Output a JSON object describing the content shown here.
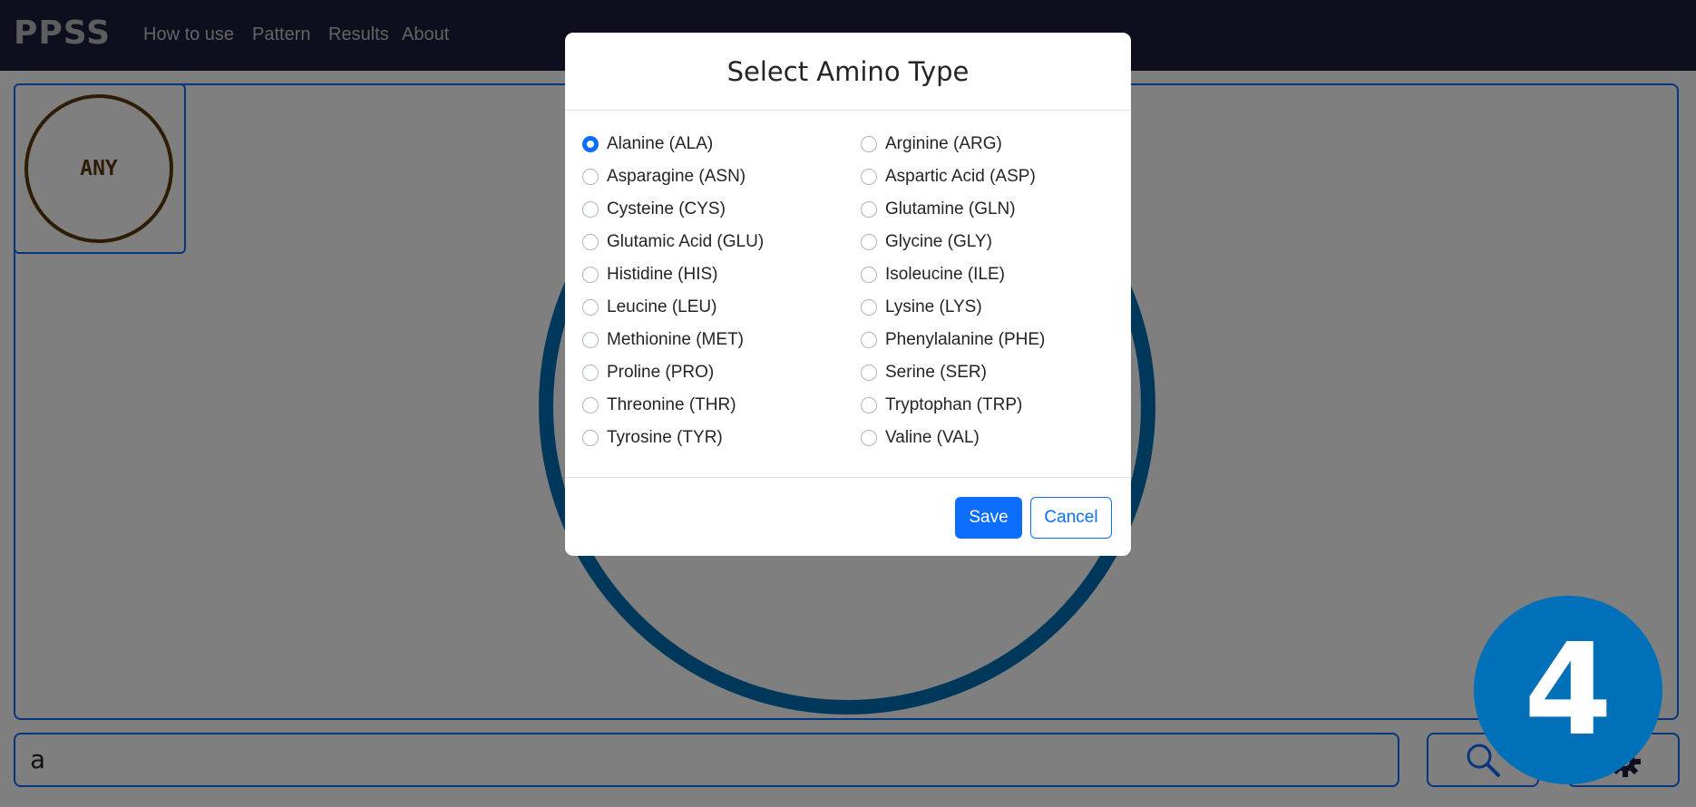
{
  "navbar": {
    "brand": "PPSS",
    "links": [
      "How to use",
      "Pattern",
      "Results",
      "About"
    ]
  },
  "canvas": {
    "any_tile_label": "ANY"
  },
  "bottom_bar": {
    "search_value": "a",
    "search_icon": "search-icon",
    "settings_icon": "gear-icon"
  },
  "step_badge": "4",
  "modal": {
    "title": "Select Amino Type",
    "selected": "Alanine (ALA)",
    "options_left": [
      "Alanine (ALA)",
      "Asparagine (ASN)",
      "Cysteine (CYS)",
      "Glutamic Acid (GLU)",
      "Histidine (HIS)",
      "Leucine (LEU)",
      "Methionine (MET)",
      "Proline (PRO)",
      "Threonine (THR)",
      "Tyrosine (TYR)"
    ],
    "options_right": [
      "Arginine (ARG)",
      "Aspartic Acid (ASP)",
      "Glutamine (GLN)",
      "Glycine (GLY)",
      "Isoleucine (ILE)",
      "Lysine (LYS)",
      "Phenylalanine (PHE)",
      "Serine (SER)",
      "Tryptophan (TRP)",
      "Valine (VAL)"
    ],
    "save_label": "Save",
    "cancel_label": "Cancel"
  },
  "colors": {
    "navbar_bg": "#1c1e3c",
    "primary": "#0d6efd",
    "ring": "#0070b8",
    "any_circle": "#5b3a0b"
  }
}
